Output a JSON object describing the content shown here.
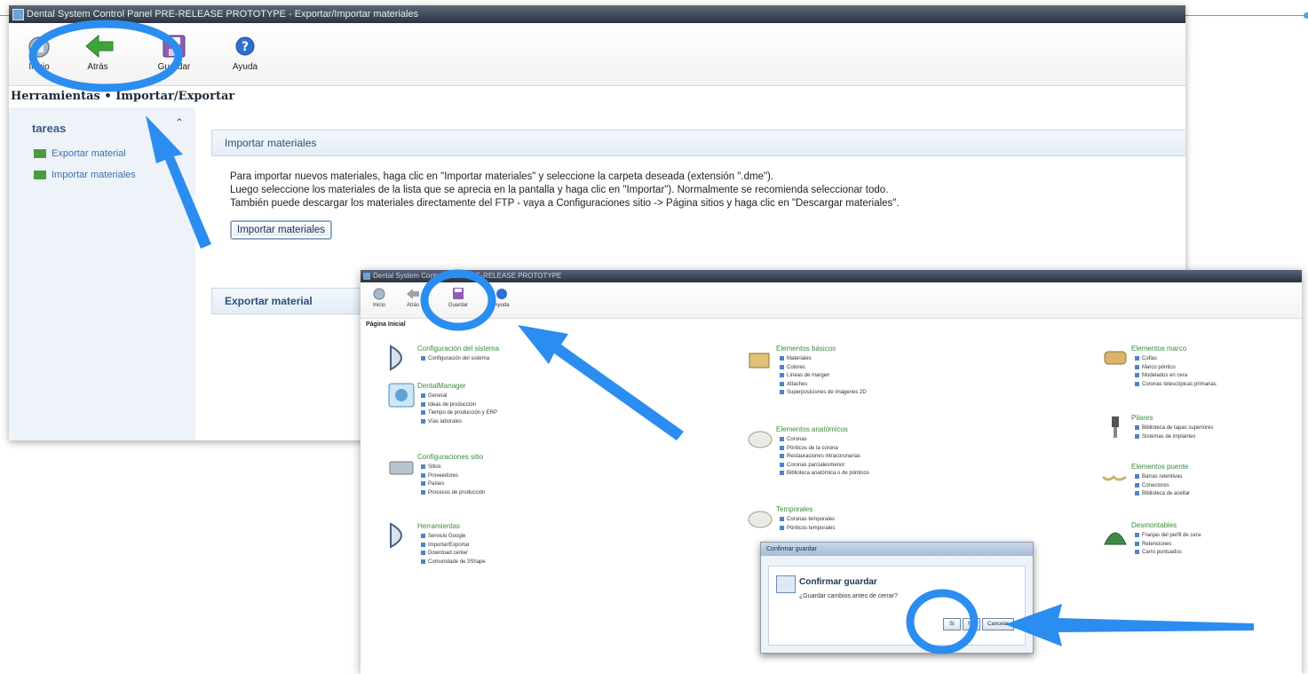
{
  "window1": {
    "title": "Dental System Control Panel PRE-RELEASE PROTOTYPE - Exportar/Importar materiales",
    "toolbar": [
      {
        "label": "Inicio",
        "icon": "home-icon"
      },
      {
        "label": "Atrás",
        "icon": "back-arrow-icon"
      },
      {
        "label": "Guardar",
        "icon": "save-icon"
      },
      {
        "label": "Ayuda",
        "icon": "help-icon"
      }
    ],
    "breadcrumb": "Herramientas • Importar/Exportar",
    "sidebar": {
      "title": "tareas",
      "items": [
        "Exportar material",
        "Importar materiales"
      ]
    },
    "import_panel": {
      "title": "Importar materiales",
      "lines": [
        "Para importar nuevos materiales, haga clic en \"Importar materiales\" y seleccione la carpeta deseada (extensión \".dme\").",
        "Luego seleccione los materiales de la lista que se aprecia en la pantalla y haga clic en \"Importar\"). Normalmente se recomienda seleccionar todo.",
        "También puede descargar los materiales directamente del FTP - vaya a Configuraciones sitio -> Página sitios y haga clic en \"Descargar materiales\"."
      ],
      "button": "Importar materiales"
    },
    "export_panel": {
      "title": "Exportar material"
    }
  },
  "window2": {
    "title": "Dental System Control Panel PRE-RELEASE PROTOTYPE",
    "toolbar": [
      {
        "label": "Inicio",
        "icon": "home-icon"
      },
      {
        "label": "Atrás",
        "icon": "back-arrow-icon"
      },
      {
        "label": "Guardar",
        "icon": "save-icon"
      },
      {
        "label": "Ayuda",
        "icon": "help-icon"
      }
    ],
    "page_title": "Página Inicial",
    "groups": {
      "config_sistema": {
        "title": "Configuración del sistema",
        "items": [
          "Configuración del sistema"
        ]
      },
      "dentalmanager": {
        "title": "DentalManager",
        "items": [
          "General",
          "Ideas de producción",
          "Tiempo de producción y ERP",
          "Vías laborales"
        ]
      },
      "config_sitio": {
        "title": "Configuraciones sitio",
        "items": [
          "Sitios",
          "Proveedores",
          "Países",
          "Procesos de producción"
        ]
      },
      "herramientas": {
        "title": "Herramientas",
        "items": [
          "Servicio Google",
          "Importar/Exportar",
          "Download center",
          "Comunidade de 3Shape"
        ]
      },
      "basicos": {
        "title": "Elementos básicos",
        "items": [
          "Materiales",
          "Colores",
          "Líneas de margen",
          "Attaches",
          "Superposiciones de imágenes 2D"
        ]
      },
      "anatomicos": {
        "title": "Elementos anatómicos",
        "items": [
          "Coronas",
          "Pónticos de la corona",
          "Restauraciones intracoronarias",
          "Coronas parcialesmenor",
          "Biblioteca anatómica o de pónticos"
        ]
      },
      "temporales": {
        "title": "Temporales",
        "items": [
          "Coronas temporales",
          "Pónticos temporales"
        ]
      },
      "marco": {
        "title": "Elementos marco",
        "items": [
          "Cofias",
          "Marco póntico",
          "Modelados en cera",
          "Coronas telescópicas primarias"
        ]
      },
      "pilares": {
        "title": "Pilares",
        "items": [
          "Biblioteca de tapas superiores",
          "Sistemas de implantes"
        ]
      },
      "puente": {
        "title": "Elementos puente",
        "items": [
          "Barras retentivas",
          "Conectores",
          "Biblioteca de aceitar"
        ]
      },
      "desmontables": {
        "title": "Desmontables",
        "items": [
          "Franjas del perfil de cera",
          "Retenciones",
          "Carro puntuados"
        ]
      }
    },
    "dialog": {
      "title": "Confirmar guardar",
      "heading": "Confirmar guardar",
      "message": "¿Guardar cambios antes de cerrar?",
      "buttons": [
        "Sí",
        "No",
        "Cancelar"
      ]
    }
  },
  "colors": {
    "annotation": "#2b8df0",
    "link": "#3a6fb0",
    "group_title": "#3c8a3c"
  }
}
